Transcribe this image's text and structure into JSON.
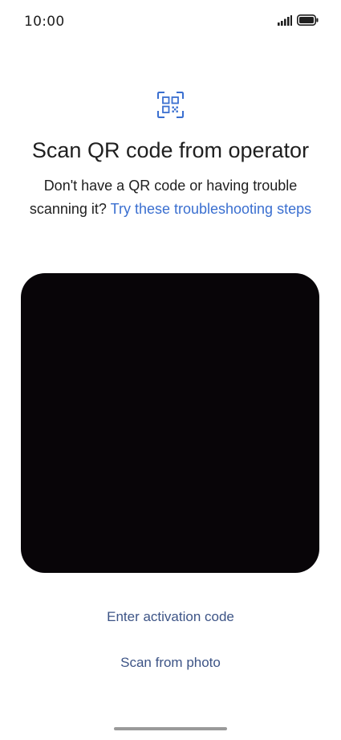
{
  "status_bar": {
    "time": "10:00",
    "signal_icon": "signal-icon",
    "battery_icon": "battery-icon"
  },
  "header": {
    "icon": "qr-code-icon",
    "title": "Scan QR code from operator",
    "subtitle_prefix": "Don't have a QR code or having trouble scanning it? ",
    "subtitle_link": "Try these troubleshooting steps"
  },
  "camera": {
    "background": "#080508"
  },
  "actions": {
    "enter_activation_code": "Enter activation code",
    "scan_from_photo": "Scan from photo"
  },
  "colors": {
    "accent": "#3a6fd0",
    "action_text": "#3d5486"
  }
}
